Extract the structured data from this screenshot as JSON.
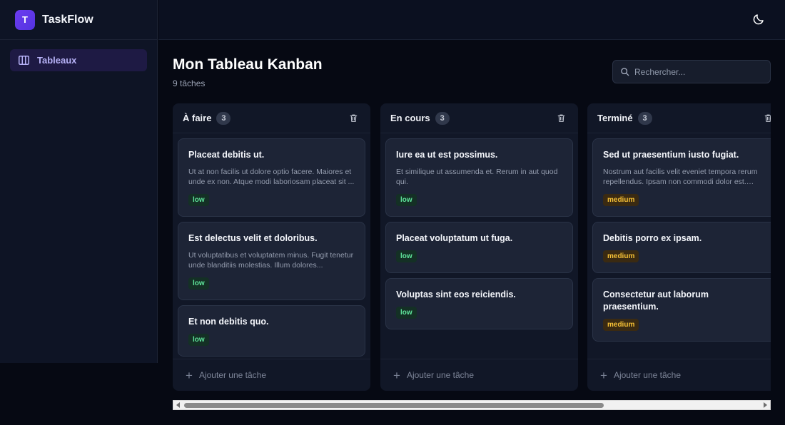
{
  "app": {
    "name": "TaskFlow",
    "logo_letter": "T"
  },
  "sidebar": {
    "items": [
      {
        "label": "Tableaux",
        "icon": "columns-icon",
        "active": true
      }
    ]
  },
  "topbar": {
    "theme_icon": "moon-icon"
  },
  "page": {
    "title": "Mon Tableau Kanban",
    "subtitle": "9 tâches"
  },
  "search": {
    "placeholder": "Rechercher...",
    "value": ""
  },
  "columns": [
    {
      "title": "À faire",
      "count": "3",
      "add_label": "Ajouter une tâche",
      "cards": [
        {
          "title": "Placeat debitis ut.",
          "description": "Ut at non facilis ut dolore optio facere. Maiores et unde ex non. Atque modi laboriosam placeat sit ...",
          "priority": "low"
        },
        {
          "title": "Est delectus velit et doloribus.",
          "description": "Ut voluptatibus et voluptatem minus. Fugit tenetur unde blanditiis molestias. Illum dolores...",
          "priority": "low"
        },
        {
          "title": "Et non debitis quo.",
          "description": "",
          "priority": "low"
        }
      ]
    },
    {
      "title": "En cours",
      "count": "3",
      "add_label": "Ajouter une tâche",
      "cards": [
        {
          "title": "Iure ea ut est possimus.",
          "description": "Et similique ut assumenda et. Rerum in aut quod qui.",
          "priority": "low"
        },
        {
          "title": "Placeat voluptatum ut fuga.",
          "description": "",
          "priority": "low"
        },
        {
          "title": "Voluptas sint eos reiciendis.",
          "description": "",
          "priority": "low"
        }
      ]
    },
    {
      "title": "Terminé",
      "count": "3",
      "add_label": "Ajouter une tâche",
      "cards": [
        {
          "title": "Sed ut praesentium iusto fugiat.",
          "description": "Nostrum aut facilis velit eveniet tempora rerum repellendus. Ipsam non commodi dolor est. Odio...",
          "priority": "medium"
        },
        {
          "title": "Debitis porro ex ipsam.",
          "description": "",
          "priority": "medium"
        },
        {
          "title": "Consectetur aut laborum praesentium.",
          "description": "",
          "priority": "medium"
        }
      ]
    }
  ],
  "colors": {
    "accent": "#6c3cf0",
    "low": "#5fe59b",
    "medium": "#f5c036",
    "background": "#060913"
  }
}
